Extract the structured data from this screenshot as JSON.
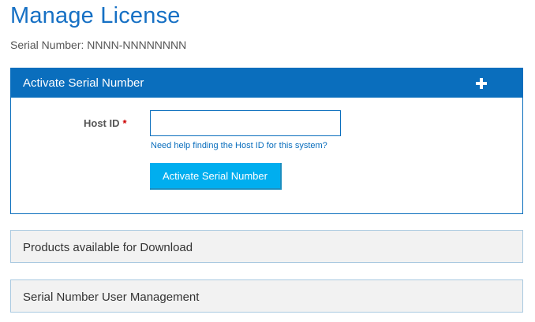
{
  "page": {
    "title": "Manage License",
    "serial_line": "Serial Number: NNNN-NNNNNNNN"
  },
  "activate_panel": {
    "title": "Activate Serial Number",
    "expand_icon": "plus-icon",
    "host_id_label": "Host ID",
    "required_marker": "*",
    "host_id_value": "",
    "host_id_placeholder": "",
    "help_link": "Need help finding the Host ID for this system?",
    "button_label": "Activate Serial Number"
  },
  "products_panel": {
    "title": "Products available for Download"
  },
  "users_panel": {
    "title": "Serial Number User Management"
  },
  "colors": {
    "brand_blue": "#0a6ebd",
    "title_blue": "#1670c4",
    "button_cyan": "#00aeef",
    "required_red": "#cc0000",
    "collapsed_bg": "#f2f2f2"
  }
}
